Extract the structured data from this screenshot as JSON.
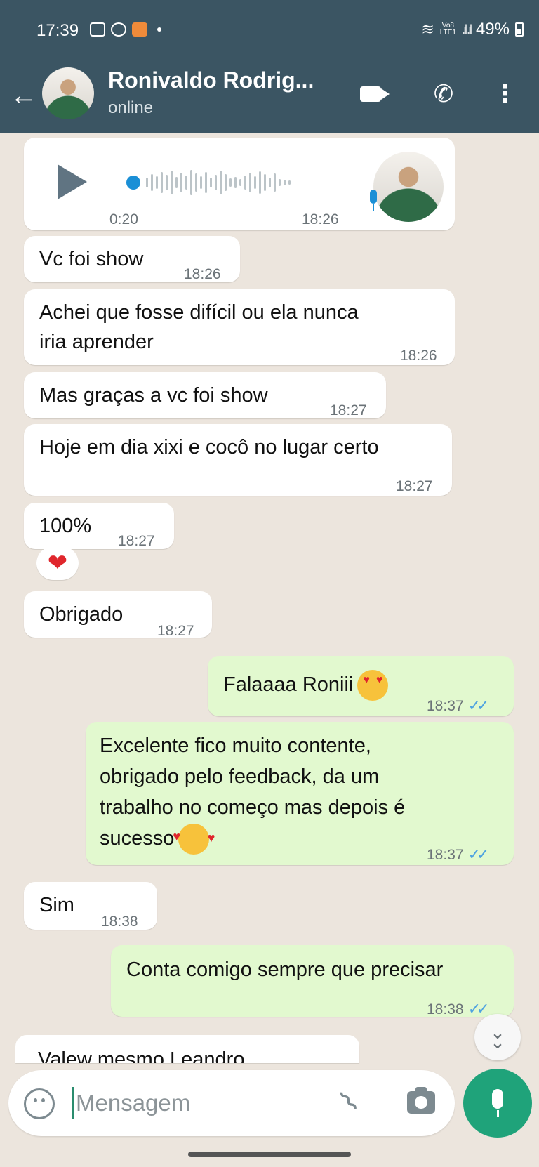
{
  "status_bar": {
    "time": "17:39",
    "network": "Vo8\nLTE1",
    "battery": "49%"
  },
  "header": {
    "contact_name": "Ronivaldo Rodrig...",
    "status": "online",
    "icons": [
      "back-arrow-icon",
      "video-call-icon",
      "voice-call-icon",
      "menu-icon"
    ]
  },
  "messages": [
    {
      "type": "voice",
      "direction": "in",
      "duration": "0:20",
      "time": "18:26"
    },
    {
      "direction": "in",
      "text": "Vc foi show",
      "time": "18:26"
    },
    {
      "direction": "in",
      "text": "Achei que fosse difícil ou ela nunca\niria aprender",
      "time": "18:26"
    },
    {
      "direction": "in",
      "text": "Mas graças a vc foi show",
      "time": "18:27"
    },
    {
      "direction": "in",
      "text": "Hoje em dia xixi e cocô no lugar certo",
      "time": "18:27"
    },
    {
      "direction": "in",
      "text": "100%",
      "time": "18:27",
      "reaction": "❤"
    },
    {
      "direction": "in",
      "text": "Obrigado",
      "time": "18:27"
    },
    {
      "direction": "out",
      "text": "Falaaaa Roniii",
      "time": "18:37",
      "emoji": "heart-eyes",
      "ticks": "✓✓"
    },
    {
      "direction": "out",
      "text": "Excelente fico muito contente,\nobrigado pelo feedback, da um\ntrabalho no começo mas depois é\nsucesso",
      "time": "18:37",
      "emoji": "smiling-with-hearts",
      "ticks": "✓✓"
    },
    {
      "direction": "in",
      "text": "Sim",
      "time": "18:38"
    },
    {
      "direction": "out",
      "text": "Conta comigo sempre que precisar",
      "time": "18:38",
      "ticks": "✓✓"
    },
    {
      "direction": "in",
      "text": "Valew mesmo Leandro"
    }
  ],
  "composer": {
    "placeholder": "Mensagem"
  },
  "colors": {
    "header": "#3b5563",
    "chat_bg": "#ece5dd",
    "incoming": "#ffffff",
    "outgoing": "#e2f9cf",
    "accent": "#1fa37a",
    "read_ticks": "#4fa3e0"
  }
}
